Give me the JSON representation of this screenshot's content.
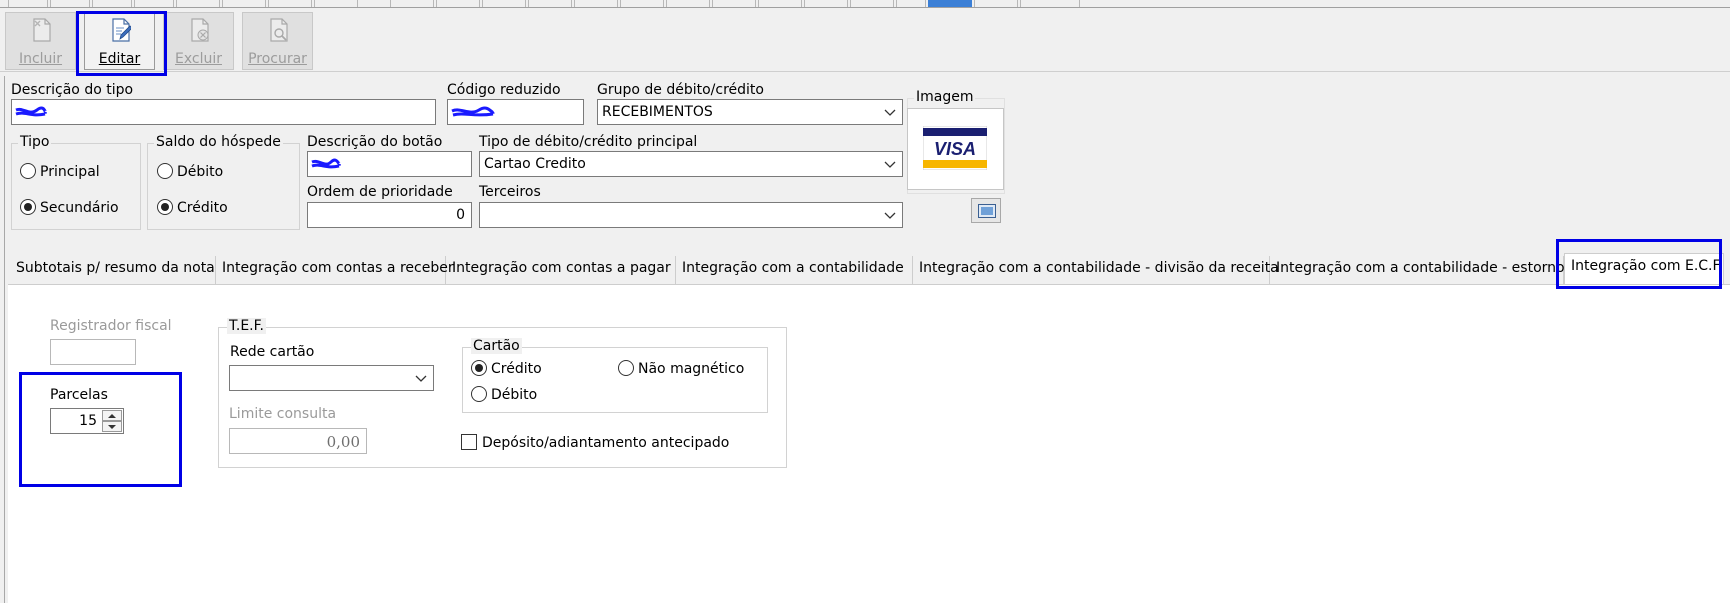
{
  "toolbar": {
    "buttons": [
      {
        "label": "Incluir",
        "enabled": false
      },
      {
        "label": "Editar",
        "enabled": true
      },
      {
        "label": "Excluir",
        "enabled": false
      },
      {
        "label": "Procurar",
        "enabled": false
      }
    ]
  },
  "form": {
    "descricao_tipo": {
      "label": "Descrição do tipo",
      "value": ""
    },
    "codigo_reduzido": {
      "label": "Código reduzido",
      "value": ""
    },
    "grupo": {
      "label": "Grupo de débito/crédito",
      "value": "RECEBIMENTOS"
    },
    "imagem": {
      "label": "Imagem",
      "logo_text": "VISA"
    },
    "tipo": {
      "label": "Tipo",
      "options": [
        "Principal",
        "Secundário"
      ],
      "selected": "Secundário"
    },
    "saldo_hospede": {
      "label": "Saldo do hóspede",
      "options": [
        "Débito",
        "Crédito"
      ],
      "selected": "Crédito"
    },
    "descricao_botao": {
      "label": "Descrição do botão",
      "value": ""
    },
    "tipo_principal": {
      "label": "Tipo de débito/crédito principal",
      "value": "Cartao Credito"
    },
    "ordem_prioridade": {
      "label": "Ordem de prioridade",
      "value": "0"
    },
    "terceiros": {
      "label": "Terceiros",
      "value": ""
    }
  },
  "tabs": [
    "Subtotais p/ resumo da nota",
    "Integração com contas a receber",
    "Integração com contas a pagar",
    "Integração com a contabilidade",
    "Integração com a contabilidade - divisão da receita",
    "Integração com a contabilidade - estorno",
    "Integração com E.C.F"
  ],
  "active_tab": "Integração com E.C.F",
  "ecf": {
    "registrador_fiscal": {
      "label": "Registrador fiscal",
      "value": ""
    },
    "parcelas": {
      "label": "Parcelas",
      "value": "15"
    },
    "tef": {
      "title": "T.E.F.",
      "rede_cartao": {
        "label": "Rede cartão",
        "value": ""
      },
      "limite_consulta": {
        "label": "Limite consulta",
        "value": "0,00"
      },
      "cartao": {
        "title": "Cartão",
        "options": [
          "Crédito",
          "Não magnético",
          "Débito"
        ],
        "selected": "Crédito"
      },
      "deposito": {
        "label": "Depósito/adiantamento antecipado",
        "checked": false
      }
    }
  },
  "colors": {
    "highlight": "#0000e6",
    "window_bg": "#f0f0f0",
    "redaction": "#1a1aff",
    "visa_blue": "#1a1f71",
    "visa_gold": "#f7b600"
  }
}
